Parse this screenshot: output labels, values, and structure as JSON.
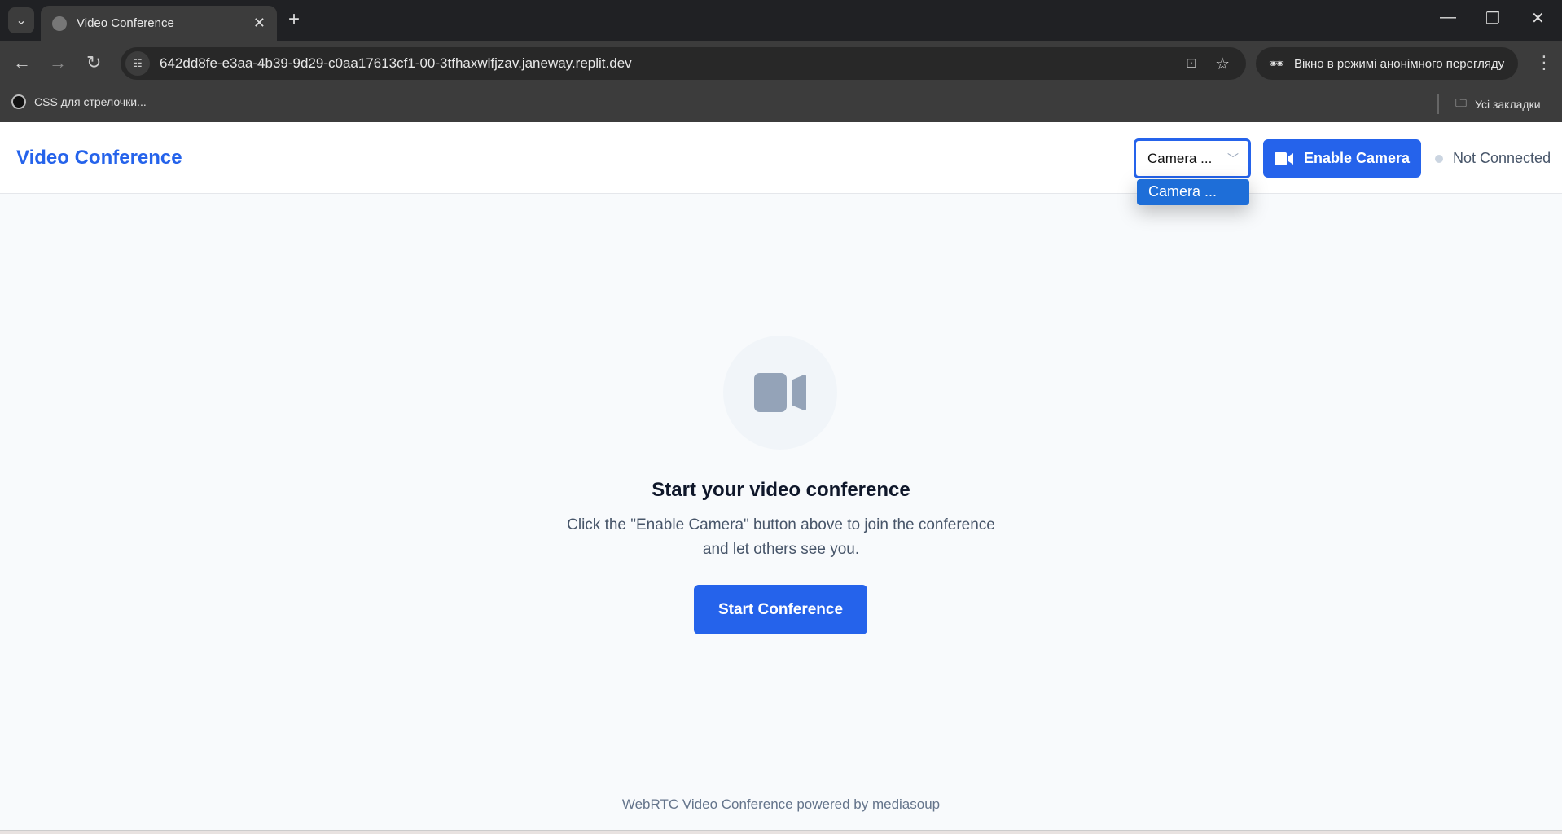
{
  "browser": {
    "tab_title": "Video Conference",
    "url": "642dd8fe-e3aa-4b39-9d29-c0aa17613cf1-00-3tfhaxwlfjzav.janeway.replit.dev",
    "incognito_label": "Вікно в режимі анонімного перегляду",
    "bookmark": "CSS для стрелочки...",
    "all_bookmarks": "Усі закладки"
  },
  "header": {
    "title": "Video Conference",
    "camera_select": {
      "value": "Camera ...",
      "options": [
        "Camera ..."
      ]
    },
    "enable_camera": "Enable Camera",
    "status": "Not Connected",
    "accent": "#2563eb"
  },
  "main": {
    "icon": "video-camera-icon",
    "heading": "Start your video conference",
    "text_line1": "Click the \"Enable Camera\" button above to join the conference",
    "text_line2": "and let others see you.",
    "start_button": "Start Conference"
  },
  "footer": {
    "text": "WebRTC Video Conference powered by mediasoup"
  }
}
